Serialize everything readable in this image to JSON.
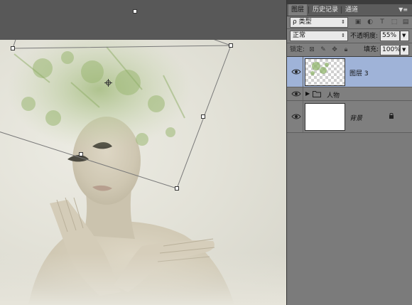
{
  "panel": {
    "tabs": [
      "图层",
      "历史记录",
      "通道"
    ],
    "menu_icon": "panel-menu-icon",
    "filter": {
      "label": "ρ 类型",
      "icons": [
        "image-filter-icon",
        "adjustment-filter-icon",
        "type-filter-icon",
        "shape-filter-icon",
        "smart-object-filter-icon"
      ]
    },
    "blend_mode": "正常",
    "opacity_label": "不透明度:",
    "opacity_value": "55%",
    "lock_label": "锁定:",
    "lock_icons": [
      "lock-transparency-icon",
      "lock-image-icon",
      "lock-position-icon",
      "lock-all-icon"
    ],
    "fill_label": "填充:",
    "fill_value": "100%"
  },
  "layers": [
    {
      "name": "图层 3",
      "type": "pixel",
      "selected": true,
      "visible": true
    },
    {
      "name": "人物",
      "type": "group",
      "selected": false,
      "visible": true
    },
    {
      "name": "背景",
      "type": "background",
      "selected": false,
      "visible": true,
      "locked": true
    }
  ],
  "canvas": {
    "content": "portrait-with-green-watercolor-overlay",
    "transform_box": "free-transform"
  },
  "colors": {
    "selection": "#9fb3d8",
    "panel_bg": "#7f7f7f",
    "app_bg": "#535353"
  }
}
